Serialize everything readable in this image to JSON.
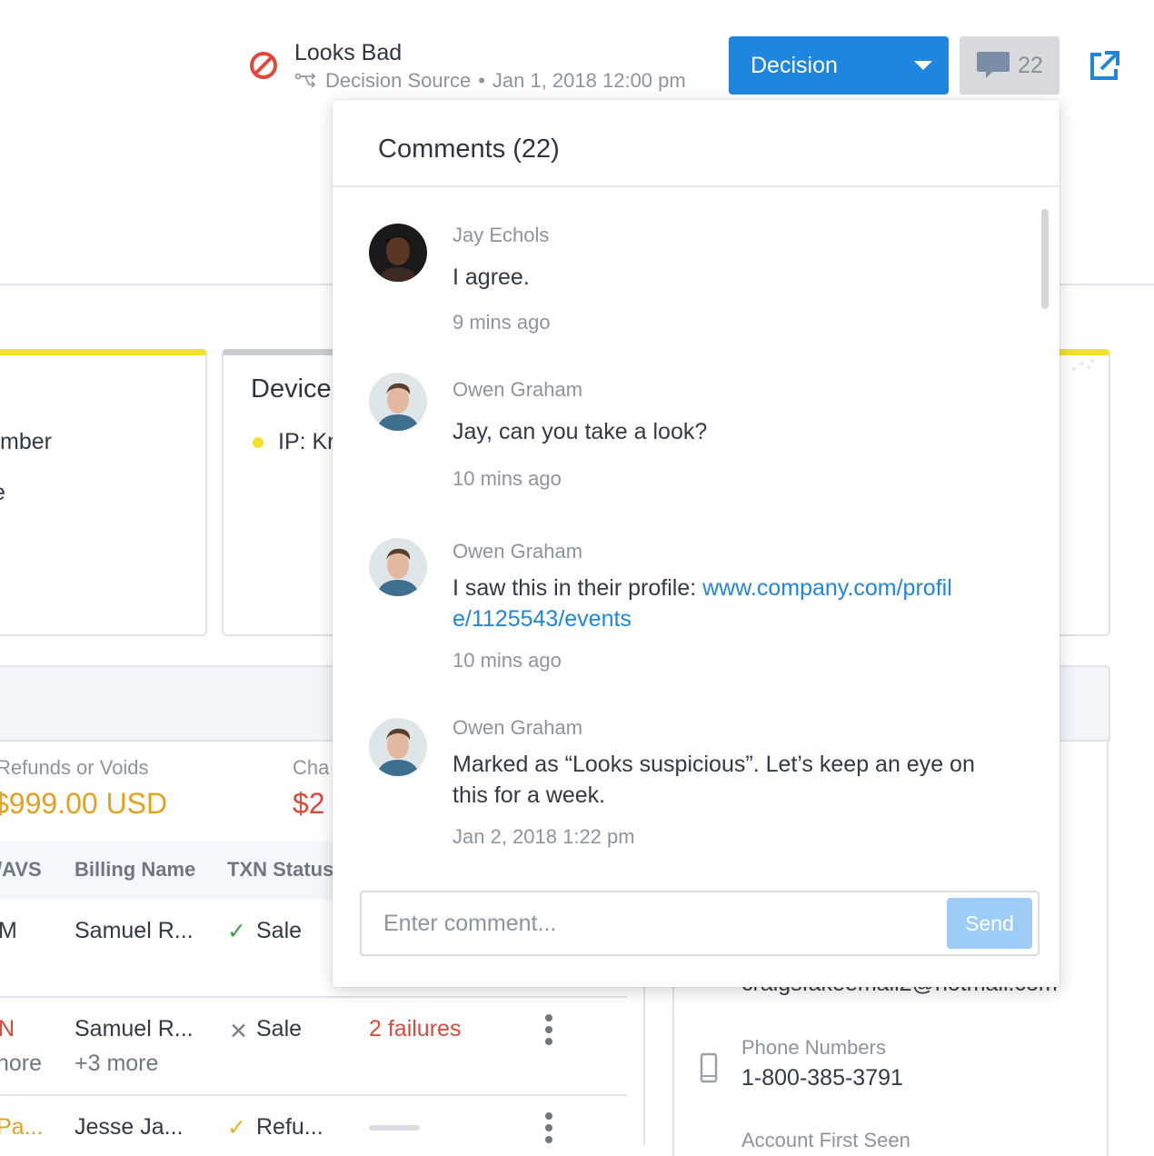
{
  "header": {
    "status_title": "Looks Bad",
    "decision_source": "Decision Source",
    "separator": "•",
    "timestamp": "Jan 1, 2018 12:00 pm",
    "decision_label": "Decision",
    "comment_count": "22"
  },
  "background": {
    "left_card_line1": "mber",
    "left_card_line2": "e",
    "device_heading": "Device",
    "device_ip": "IP: Kr",
    "refunds_label": "Refunds or Voids",
    "refunds_amount": "$999.00 USD",
    "charge_label": "Cha",
    "charge_amount": "$2",
    "table_headers": [
      "/AVS",
      "Billing Name",
      "TXN Status"
    ],
    "rows": [
      {
        "col1": "M",
        "name": "Samuel R...",
        "status": "Sale"
      },
      {
        "col1": "N",
        "col1_more": "nore",
        "name": "Samuel R...",
        "name_more": "+3 more",
        "status": "Sale",
        "failures": "2 failures"
      },
      {
        "col1": "Pa...",
        "name": "Jesse Ja...",
        "status": "Refu..."
      }
    ],
    "email_partial": "craigsfakeemail2@hotmail.com",
    "phone_label": "Phone Numbers",
    "phone_value": "1-800-385-3791",
    "account_label": "Account First Seen"
  },
  "comments": {
    "title": "Comments (22)",
    "items": [
      {
        "author": "Jay Echols",
        "body": "I agree.",
        "time": "9 mins ago"
      },
      {
        "author": "Owen Graham",
        "body": "Jay, can you take a look?",
        "time": "10 mins ago"
      },
      {
        "author": "Owen Graham",
        "body_prefix": "I saw this in their profile: ",
        "link": "www.company.com/profile/1125543/events",
        "time": "10 mins ago"
      },
      {
        "author": "Owen Graham",
        "body": "Marked as “Looks suspicious”. Let’s keep an eye on this for a week.",
        "time": "Jan 2, 2018 1:22 pm"
      }
    ],
    "input_placeholder": "Enter comment...",
    "send_label": "Send"
  },
  "colors": {
    "primary": "#1f86e0",
    "danger": "#e0483a",
    "warning": "#e6a01e",
    "highlight": "#f4df2a"
  }
}
